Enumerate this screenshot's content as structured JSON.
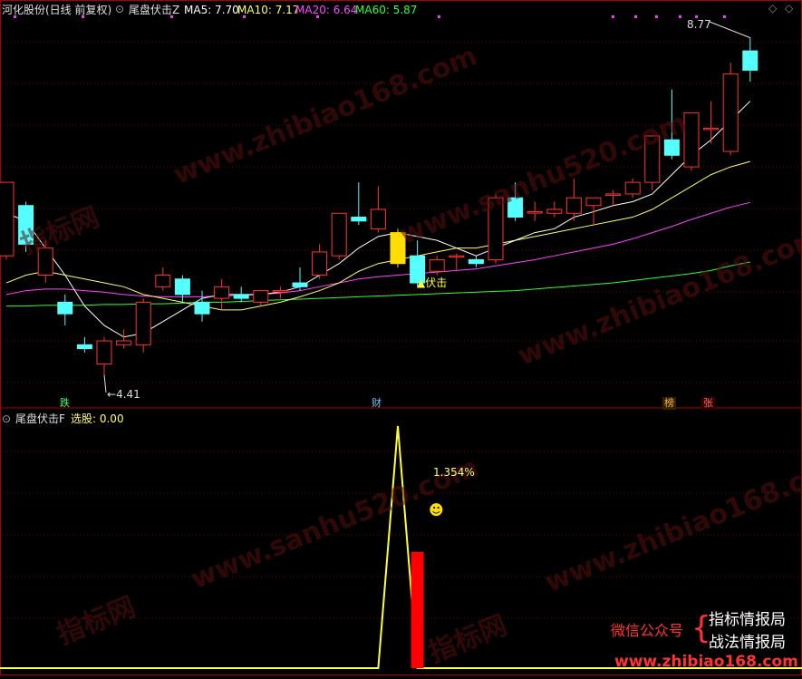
{
  "header": {
    "stock": "河化股份(日线 前复权)",
    "indicator": "尾盘伏击Z",
    "ma5": "MA5: 7.70",
    "ma10": "MA10: 7.17",
    "ma20": "MA20: 6.64",
    "ma60": "MA60: 5.87",
    "colors": {
      "ma5": "#ffffff",
      "ma10": "#ffff66",
      "ma20": "#ff44ff",
      "ma60": "#33ff33"
    }
  },
  "sub_header": {
    "indicator": "尾盘伏击F",
    "select_label": "选股: 0.00"
  },
  "annotations": {
    "high": "8.77",
    "low": "4.41",
    "signal": "▲伏击",
    "pct": "1.354%",
    "tags": [
      "跌",
      "财",
      "榜",
      "张"
    ]
  },
  "brand": {
    "wechat": "微信公众号",
    "line1": "指标情报局",
    "line2": "战法情报局",
    "url": "www.zhibiao168.com"
  },
  "watermarks": [
    "www.zhibiao168.com",
    "www.sanhu520.com",
    "指标网"
  ],
  "chart_data": {
    "type": "candlestick",
    "title": "河化股份(日线 前复权)",
    "candles": [
      {
        "o": 5.95,
        "c": 6.9,
        "h": 6.9,
        "l": 5.9
      },
      {
        "o": 6.6,
        "c": 6.1,
        "h": 6.65,
        "l": 6.0
      },
      {
        "o": 5.7,
        "c": 6.05,
        "h": 6.15,
        "l": 5.6
      },
      {
        "o": 5.35,
        "c": 5.2,
        "h": 5.45,
        "l": 5.05
      },
      {
        "o": 4.8,
        "c": 4.75,
        "h": 4.9,
        "l": 4.7
      },
      {
        "o": 4.55,
        "c": 4.85,
        "h": 4.9,
        "l": 4.41
      },
      {
        "o": 4.8,
        "c": 4.85,
        "h": 5.0,
        "l": 4.75
      },
      {
        "o": 4.8,
        "c": 5.35,
        "h": 5.4,
        "l": 4.7
      },
      {
        "o": 5.55,
        "c": 5.7,
        "h": 5.8,
        "l": 5.5
      },
      {
        "o": 5.65,
        "c": 5.45,
        "h": 5.7,
        "l": 5.35
      },
      {
        "o": 5.35,
        "c": 5.2,
        "h": 5.5,
        "l": 5.1
      },
      {
        "o": 5.4,
        "c": 5.55,
        "h": 5.65,
        "l": 5.25
      },
      {
        "o": 5.45,
        "c": 5.4,
        "h": 5.55,
        "l": 5.35
      },
      {
        "o": 5.35,
        "c": 5.5,
        "h": 5.5,
        "l": 5.3
      },
      {
        "o": 5.5,
        "c": 5.5,
        "h": 5.55,
        "l": 5.4
      },
      {
        "o": 5.6,
        "c": 5.55,
        "h": 5.8,
        "l": 5.5
      },
      {
        "o": 5.7,
        "c": 6.0,
        "h": 6.1,
        "l": 5.65
      },
      {
        "o": 5.95,
        "c": 6.5,
        "h": 6.5,
        "l": 5.9
      },
      {
        "o": 6.45,
        "c": 6.4,
        "h": 6.9,
        "l": 6.35
      },
      {
        "o": 6.3,
        "c": 6.55,
        "h": 6.85,
        "l": 6.25
      },
      {
        "o": 6.25,
        "c": 5.85,
        "h": 6.3,
        "l": 5.8
      },
      {
        "o": 5.95,
        "c": 5.6,
        "h": 6.15,
        "l": 5.55
      },
      {
        "o": 5.75,
        "c": 5.9,
        "h": 5.95,
        "l": 5.7
      },
      {
        "o": 5.95,
        "c": 5.95,
        "h": 5.98,
        "l": 5.75
      },
      {
        "o": 5.9,
        "c": 5.85,
        "h": 5.95,
        "l": 5.8
      },
      {
        "o": 5.9,
        "c": 6.7,
        "h": 6.75,
        "l": 5.85
      },
      {
        "o": 6.7,
        "c": 6.45,
        "h": 6.9,
        "l": 6.4
      },
      {
        "o": 6.52,
        "c": 6.52,
        "h": 6.65,
        "l": 6.4
      },
      {
        "o": 6.5,
        "c": 6.55,
        "h": 6.65,
        "l": 6.45
      },
      {
        "o": 6.5,
        "c": 6.7,
        "h": 6.95,
        "l": 6.4
      },
      {
        "o": 6.6,
        "c": 6.7,
        "h": 6.7,
        "l": 6.35
      },
      {
        "o": 6.75,
        "c": 6.75,
        "h": 6.8,
        "l": 6.6
      },
      {
        "o": 6.75,
        "c": 6.9,
        "h": 6.95,
        "l": 6.7
      },
      {
        "o": 6.9,
        "c": 7.5,
        "h": 7.5,
        "l": 6.8
      },
      {
        "o": 7.45,
        "c": 7.25,
        "h": 8.1,
        "l": 7.2
      },
      {
        "o": 7.1,
        "c": 7.8,
        "h": 7.8,
        "l": 7.05
      },
      {
        "o": 7.6,
        "c": 7.6,
        "h": 7.95,
        "l": 7.4
      },
      {
        "o": 7.3,
        "c": 8.3,
        "h": 8.45,
        "l": 7.25
      },
      {
        "o": 8.6,
        "c": 8.35,
        "h": 8.77,
        "l": 8.2
      }
    ],
    "ma5": [
      6.5,
      6.4,
      6.05,
      5.7,
      5.3,
      5.05,
      4.9,
      4.95,
      5.1,
      5.25,
      5.4,
      5.45,
      5.45,
      5.45,
      5.48,
      5.55,
      5.7,
      5.85,
      6.05,
      6.2,
      6.25,
      6.2,
      6.15,
      6.05,
      5.95,
      6.05,
      6.15,
      6.25,
      6.3,
      6.45,
      6.52,
      6.6,
      6.65,
      6.75,
      7.0,
      7.25,
      7.45,
      7.7,
      7.95
    ],
    "ma10": [
      5.6,
      5.7,
      5.75,
      5.7,
      5.65,
      5.6,
      5.55,
      5.45,
      5.4,
      5.35,
      5.3,
      5.25,
      5.25,
      5.3,
      5.35,
      5.42,
      5.5,
      5.6,
      5.75,
      5.85,
      5.9,
      5.95,
      6.0,
      6.05,
      6.05,
      6.1,
      6.15,
      6.2,
      6.25,
      6.3,
      6.35,
      6.4,
      6.45,
      6.55,
      6.7,
      6.85,
      7.0,
      7.1,
      7.17
    ],
    "ma20": [
      5.45,
      5.5,
      5.52,
      5.52,
      5.5,
      5.48,
      5.45,
      5.43,
      5.42,
      5.42,
      5.42,
      5.43,
      5.44,
      5.45,
      5.47,
      5.5,
      5.55,
      5.6,
      5.65,
      5.68,
      5.7,
      5.72,
      5.74,
      5.76,
      5.78,
      5.82,
      5.86,
      5.9,
      5.95,
      6.0,
      6.05,
      6.1,
      6.17,
      6.25,
      6.33,
      6.42,
      6.5,
      6.58,
      6.64
    ],
    "ma60": [
      5.3,
      5.3,
      5.31,
      5.31,
      5.31,
      5.32,
      5.32,
      5.33,
      5.33,
      5.34,
      5.35,
      5.35,
      5.36,
      5.37,
      5.38,
      5.39,
      5.4,
      5.41,
      5.42,
      5.43,
      5.44,
      5.45,
      5.46,
      5.47,
      5.48,
      5.49,
      5.5,
      5.52,
      5.54,
      5.56,
      5.58,
      5.6,
      5.63,
      5.66,
      5.69,
      5.72,
      5.76,
      5.82,
      5.87
    ],
    "ylim": [
      4.1,
      9.0
    ],
    "signal_index": 20,
    "sub_line": [
      0,
      0,
      0,
      0,
      0,
      0,
      0,
      0,
      0,
      0,
      0,
      0,
      0,
      0,
      0,
      0,
      0,
      0,
      0,
      0,
      100,
      0,
      0,
      0,
      0,
      0,
      0,
      0,
      0,
      0,
      0,
      0,
      0,
      0,
      0,
      0,
      0,
      0,
      0
    ],
    "sub_bar_index": 21,
    "sub_bar_value": 48
  }
}
